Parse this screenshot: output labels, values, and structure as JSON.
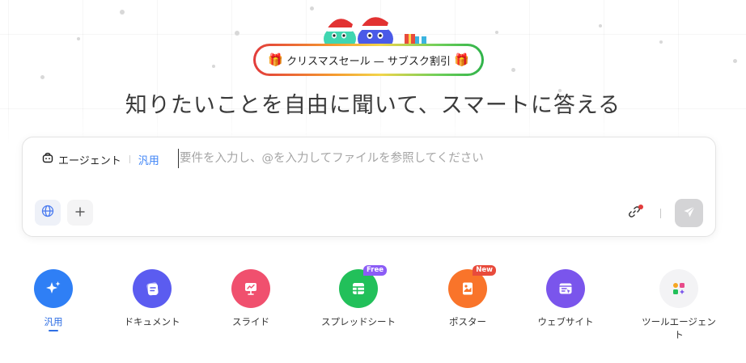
{
  "promo": {
    "label": "クリスマスセール — サブスク割引",
    "gift_emoji": "🎁"
  },
  "headline": "知りたいことを自由に聞いて、スマートに答える",
  "composer": {
    "agent_label": "エージェント",
    "mode_label": "汎用",
    "placeholder": "要件を入力し、@を入力してファイルを参照してください",
    "value": ""
  },
  "tiles": [
    {
      "label": "汎用",
      "icon": "sparkle-icon",
      "color": "#2f7ff5",
      "active": true,
      "badge": ""
    },
    {
      "label": "ドキュメント",
      "icon": "document-icon",
      "color": "#5b5cf0",
      "active": false,
      "badge": ""
    },
    {
      "label": "スライド",
      "icon": "presentation-icon",
      "color": "#f0506e",
      "active": false,
      "badge": ""
    },
    {
      "label": "スプレッドシート",
      "icon": "spreadsheet-icon",
      "color": "#22c05a",
      "active": false,
      "badge": "Free"
    },
    {
      "label": "ポスター",
      "icon": "poster-icon",
      "color": "#f9742a",
      "active": false,
      "badge": "New"
    },
    {
      "label": "ウェブサイト",
      "icon": "website-icon",
      "color": "#7a55ec",
      "active": false,
      "badge": ""
    },
    {
      "label": "ツールエージェント",
      "icon": "tool-agent-icon",
      "color": "#f3f3f5",
      "active": false,
      "badge": ""
    }
  ],
  "colors": {
    "accent": "#2f6fe4",
    "send_disabled": "#d4d4d6",
    "free_badge": "#8b5cf6",
    "new_badge": "#e84b3c"
  }
}
